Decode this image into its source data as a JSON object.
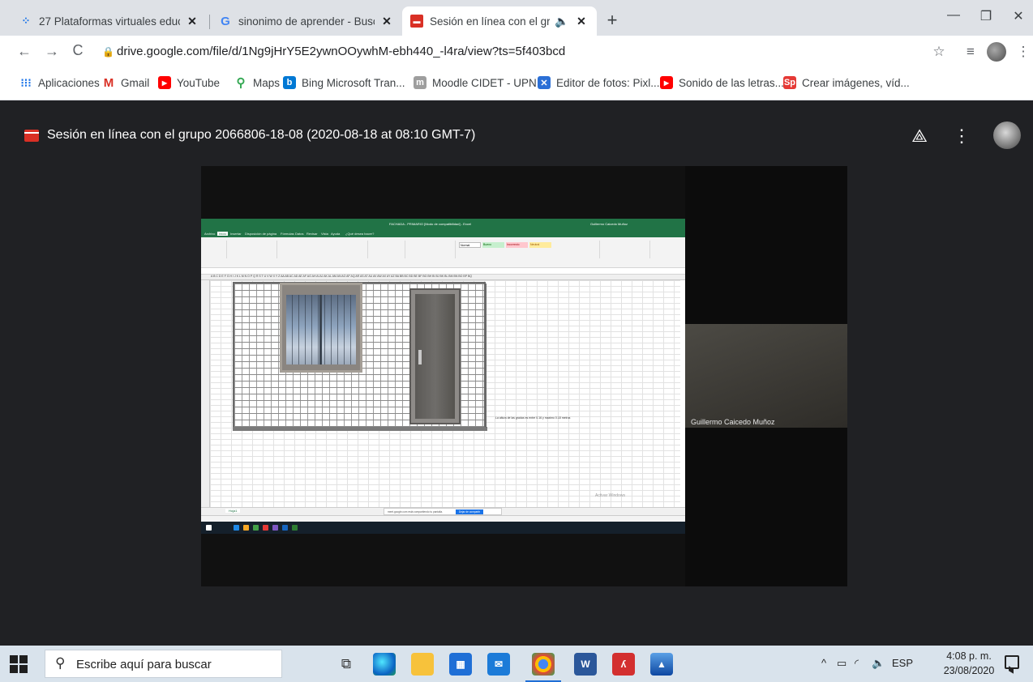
{
  "browser": {
    "tabs": [
      {
        "title": "27 Plataformas virtuales educativ",
        "icon": "loading-spinner-icon",
        "active": false
      },
      {
        "title": "sinonimo de aprender - Buscar c",
        "icon": "google-g-icon",
        "active": false
      },
      {
        "title": "Sesión en línea con el grupo",
        "icon": "video-clapper-icon",
        "active": true
      }
    ],
    "new_tab": "+",
    "url": "drive.google.com/file/d/1Ng9jHrY5E2ywnOOywhM-ebh440_-l4ra/view?ts=5f403bcd",
    "bookmarks": [
      {
        "label": "Aplicaciones",
        "icon": "apps-grid-icon"
      },
      {
        "label": "Gmail",
        "icon": "gmail-icon"
      },
      {
        "label": "YouTube",
        "icon": "youtube-icon"
      },
      {
        "label": "Maps",
        "icon": "maps-pin-icon"
      },
      {
        "label": "Bing Microsoft Tran...",
        "icon": "bing-icon"
      },
      {
        "label": "Moodle CIDET - UPN",
        "icon": "moodle-icon"
      },
      {
        "label": "Editor de fotos: Pixl...",
        "icon": "pixlr-icon"
      },
      {
        "label": "Sonido de las letras...",
        "icon": "youtube-icon"
      },
      {
        "label": "Crear imágenes, víd...",
        "icon": "spark-icon"
      }
    ]
  },
  "viewer": {
    "title": "Sesión en línea con el grupo 2066806-18-08 (2020-08-18 at 08:10 GMT-7)",
    "participant_name": "Guillermo Caicedo Muñoz"
  },
  "shared_screen": {
    "excel_title": "FACHADA - PRIMARIO [Modo de compatibilidad] - Excel",
    "excel_user": "Guillermo Caicedo Muñoz",
    "ribbon_tabs": [
      "Archivo",
      "Inicio",
      "Insertar",
      "Disposición de página",
      "Fórmulas",
      "Datos",
      "Revisar",
      "Vista",
      "Ayuda",
      "¿Qué desea hacer?"
    ],
    "styles": [
      "Normal",
      "Bueno",
      "Incorrecto",
      "Neutral"
    ],
    "column_letters": "A B C D E F G H I J K L M N O P Q R S T U V W X Y Z AA AB AC AD AE AF AG AH AI AJ AK AL AM AN AO AP AQ AR AS AT AU AV AW AX AY AZ BA BB BC BD BE BF BG BH   BI   BJ   BK   BL   BM   BN   BO   BP   BQ",
    "note": "La altura de las gradas es entre 0.16 y maximo 0.18 metros",
    "sheet_tab": "Hoja1",
    "share_notice": "meet.google.com está compartiendo tu pantalla.",
    "share_stop": "Dejar de compartir",
    "activate_windows": "Activar Windows"
  },
  "taskbar": {
    "search_placeholder": "Escribe aquí para buscar",
    "language": "ESP",
    "time": "4:08 p. m.",
    "date": "23/08/2020"
  },
  "colors": {
    "excel_green": "#217346",
    "viewer_bg": "#202124",
    "accent_blue": "#1a73e8"
  }
}
